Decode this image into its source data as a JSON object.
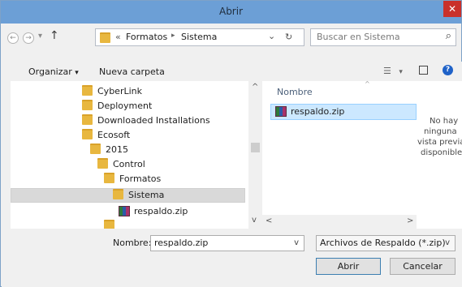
{
  "window": {
    "title": "Abrir",
    "close_glyph": "✕"
  },
  "nav": {
    "back_glyph": "←",
    "forward_glyph": "→",
    "dropdown_glyph": "▾",
    "up_glyph": "↑",
    "breadcrumb_prefix": "«",
    "breadcrumb": [
      "Formatos",
      "Sistema"
    ],
    "breadcrumb_sep": "▸",
    "addr_dropdown_glyph": "⌄",
    "refresh_glyph": "↻",
    "search_placeholder": "Buscar en Sistema",
    "search_glyph": "⌕"
  },
  "commandbar": {
    "organize_label": "Organizar",
    "organize_arrow": "▾",
    "newfolder_label": "Nueva carpeta",
    "view_glyph": "☰",
    "view_arrow": "▾",
    "help_glyph": "?"
  },
  "tree": {
    "items": [
      {
        "label": "CyberLink",
        "icon": "folder-icon"
      },
      {
        "label": "Deployment",
        "icon": "folder-icon"
      },
      {
        "label": "Downloaded Installations",
        "icon": "folder-icon"
      },
      {
        "label": "Ecosoft",
        "icon": "folder-icon"
      },
      {
        "label": "2015",
        "icon": "folder-icon"
      },
      {
        "label": "Control",
        "icon": "folder-icon"
      },
      {
        "label": "Formatos",
        "icon": "folder-icon"
      },
      {
        "label": "Sistema",
        "icon": "folder-icon",
        "selected": true
      },
      {
        "label": "respaldo.zip",
        "icon": "winrar-archive-icon"
      }
    ],
    "scroll_up_glyph": "^",
    "scroll_down_glyph": "v"
  },
  "files": {
    "column_header": "Nombre",
    "sort_glyph": "^",
    "items": [
      {
        "label": "respaldo.zip",
        "icon": "winrar-archive-icon",
        "selected": true
      }
    ],
    "scroll_left_glyph": "<",
    "scroll_right_glyph": ">"
  },
  "preview": {
    "lines": [
      "No hay",
      "ninguna",
      "vista previa",
      "disponible."
    ]
  },
  "bottom": {
    "filename_label": "Nombre:",
    "filename_value": "respaldo.zip",
    "filename_dropdown_glyph": "v",
    "filetype_value": "Archivos de Respaldo (*.zip)",
    "filetype_dropdown_glyph": "v",
    "open_label": "Abrir",
    "cancel_label": "Cancelar"
  },
  "colors": {
    "titlebar": "#6c9fd6",
    "selection": "#cce8ff",
    "close": "#c9312b",
    "folder": "#e8b73f"
  }
}
